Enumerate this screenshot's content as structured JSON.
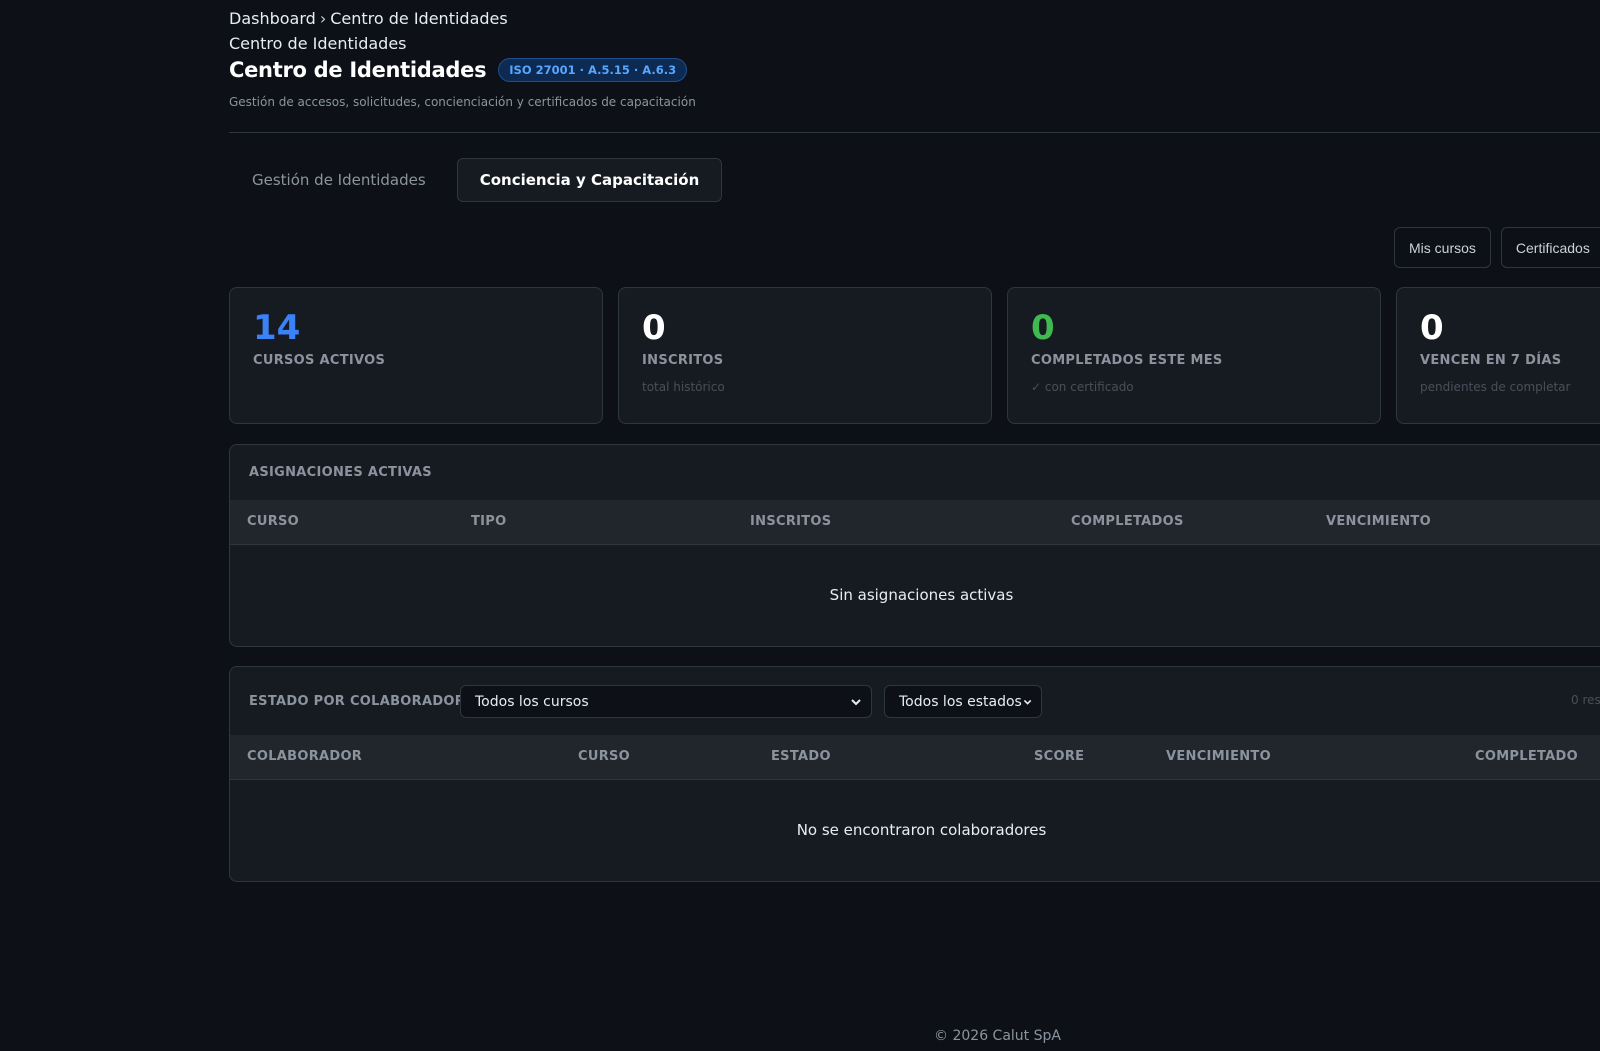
{
  "breadcrumb": {
    "root": "Dashboard",
    "separator": "›",
    "current": "Centro de Identidades"
  },
  "sub_breadcrumb": "Centro de Identidades",
  "header": {
    "title": "Centro de Identidades",
    "badge": "ISO 27001 · A.5.15 · A.6.3",
    "description": "Gestión de accesos, solicitudes, concienciación y certificados de capacitación"
  },
  "tabs": [
    {
      "label": "Gestión de Identidades",
      "active": false
    },
    {
      "label": "Conciencia y Capacitación",
      "active": true
    }
  ],
  "actions": {
    "my_courses": "Mis cursos",
    "certificates": "Certificados"
  },
  "stats": [
    {
      "value": "14",
      "label": "CURSOS ACTIVOS",
      "hint": "",
      "color": "#3b82f6"
    },
    {
      "value": "0",
      "label": "INSCRITOS",
      "hint": "total histórico",
      "color": "#ffffff"
    },
    {
      "value": "0",
      "label": "COMPLETADOS ESTE MES",
      "hint": "✓ con certificado",
      "color": "#3fb950"
    },
    {
      "value": "0",
      "label": "VENCEN EN 7 DÍAS",
      "hint": "pendientes de completar",
      "color": "#ffffff"
    }
  ],
  "assignments": {
    "title": "ASIGNACIONES ACTIVAS",
    "columns": [
      "CURSO",
      "TIPO",
      "INSCRITOS",
      "COMPLETADOS",
      "VENCIMIENTO"
    ],
    "empty": "Sin asignaciones activas"
  },
  "collaborators": {
    "title": "ESTADO POR COLABORADOR",
    "course_filter": "Todos los cursos",
    "status_filter": "Todos los estados",
    "results": "0 res",
    "columns": [
      "COLABORADOR",
      "CURSO",
      "ESTADO",
      "SCORE",
      "VENCIMIENTO",
      "COMPLETADO"
    ],
    "empty": "No se encontraron colaboradores"
  },
  "footer": "© 2026 Calut SpA"
}
